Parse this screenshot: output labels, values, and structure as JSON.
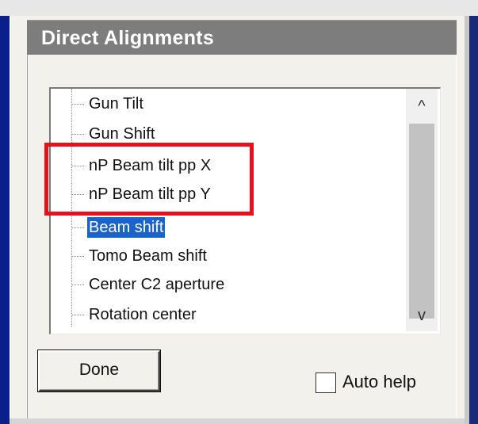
{
  "window": {
    "title": "Direct Alignments"
  },
  "list": {
    "items": [
      {
        "label": "Gun Tilt",
        "selected": false
      },
      {
        "label": "Gun Shift",
        "selected": false
      },
      {
        "label": "nP Beam tilt pp X",
        "selected": false
      },
      {
        "label": "nP Beam tilt pp Y",
        "selected": false
      },
      {
        "label": "Beam shift",
        "selected": true
      },
      {
        "label": "Tomo Beam shift",
        "selected": false
      },
      {
        "label": "Center C2 aperture",
        "selected": false
      },
      {
        "label": "Rotation center",
        "selected": false
      }
    ],
    "scroll_up_icon": "^",
    "scroll_down_icon": "v"
  },
  "buttons": {
    "done_label": "Done"
  },
  "auto_help": {
    "label": "Auto help",
    "checked": false
  },
  "colors": {
    "highlight": "#e3121b",
    "selection": "#1a63c9",
    "titlebar": "#7d7d7d"
  }
}
